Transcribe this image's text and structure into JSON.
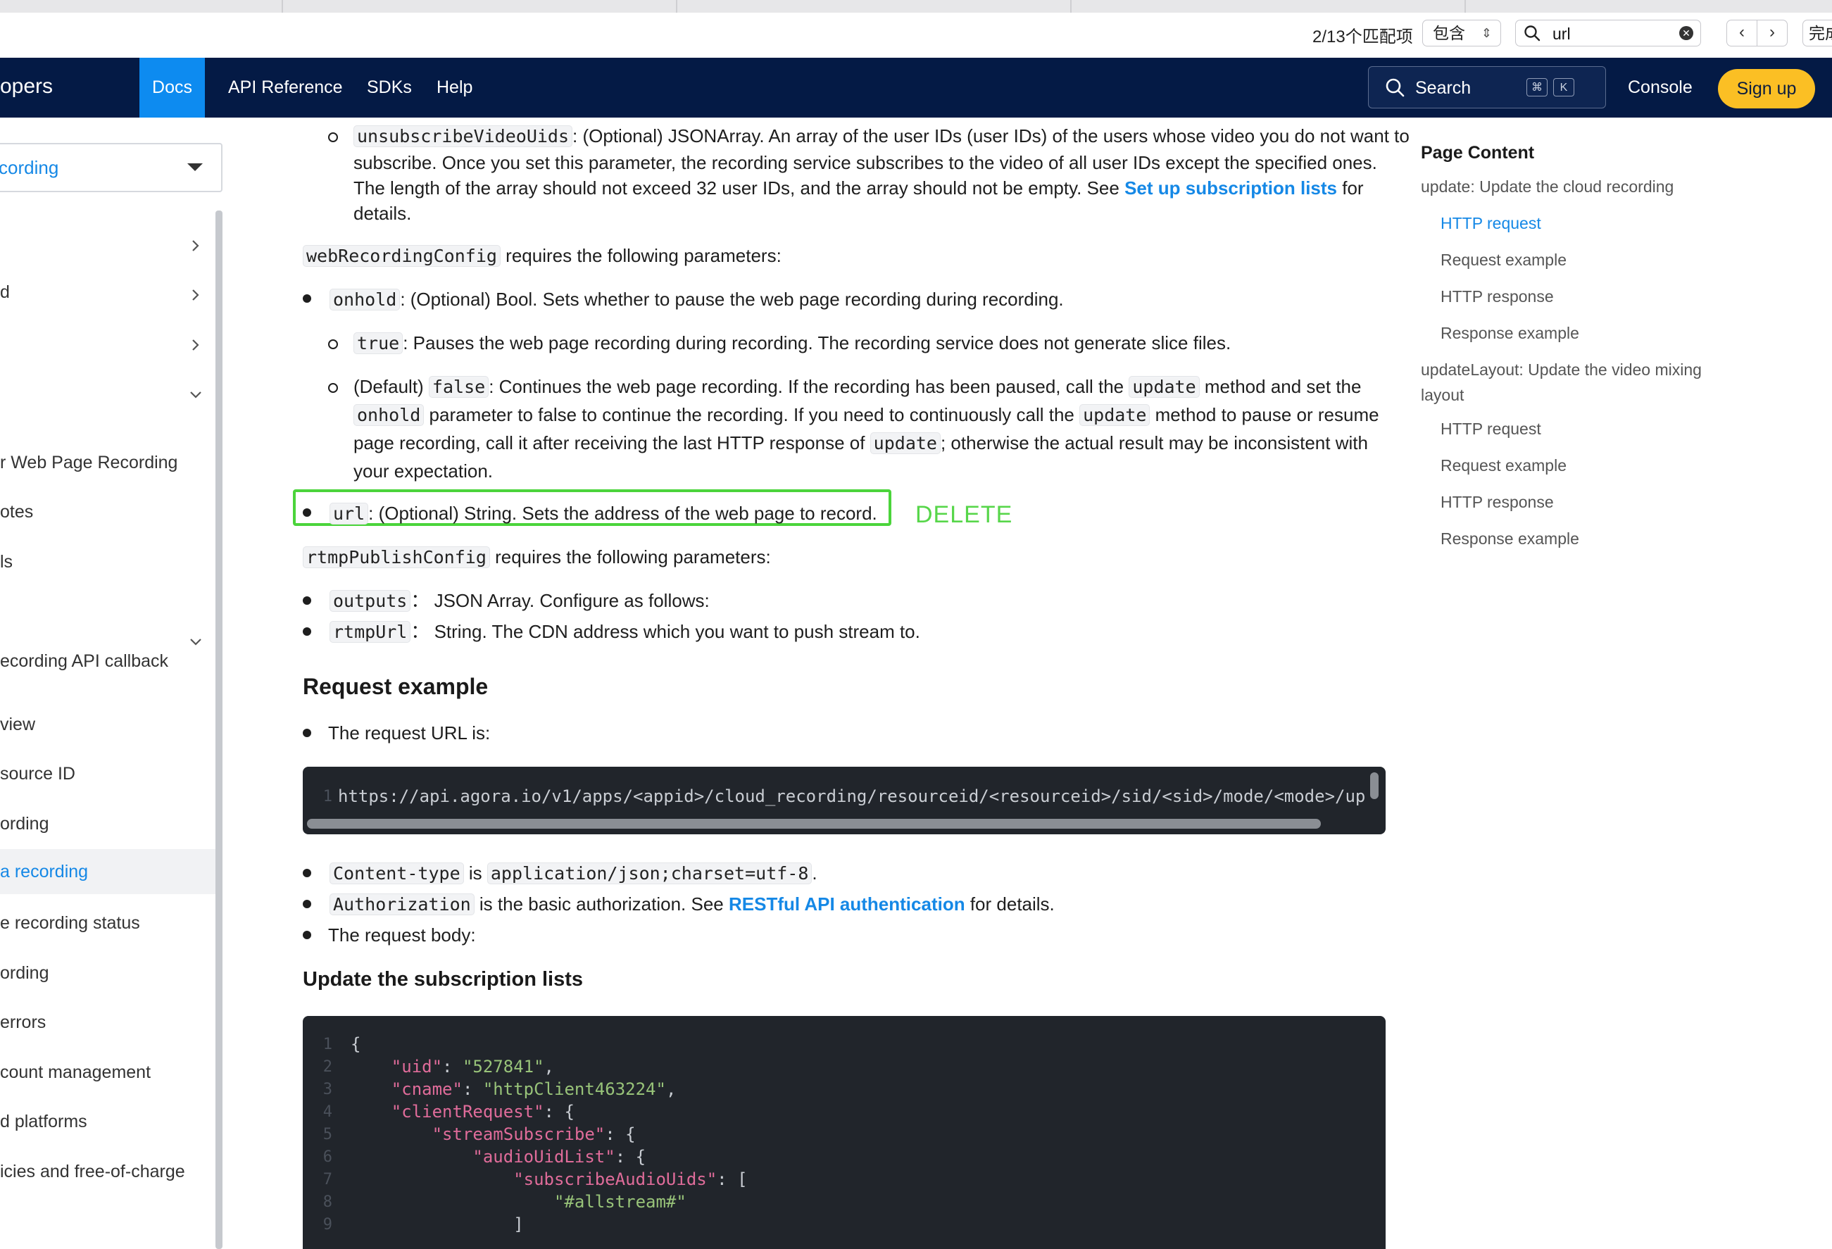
{
  "find_bar": {
    "match_count": "2/13个匹配项",
    "mode": "包含",
    "query": "url",
    "done_label": "完成"
  },
  "nav": {
    "brand": "opers",
    "docs": "Docs",
    "api_reference": "API Reference",
    "sdks": "SDKs",
    "help": "Help",
    "search_label": "Search",
    "kbd_cmd": "⌘",
    "kbd_k": "K",
    "console": "Console",
    "signup": "Sign up"
  },
  "sidebar": {
    "select_label": "cording",
    "items": [
      {
        "label": "",
        "chevron": "right"
      },
      {
        "label": "d",
        "chevron": "right"
      },
      {
        "label": "",
        "chevron": "right"
      },
      {
        "label": "",
        "chevron": "down"
      },
      {
        "label": "r Web Page Recording"
      },
      {
        "label": "otes"
      },
      {
        "label": "ls"
      },
      {
        "label": "",
        "chevron": "down"
      },
      {
        "label": "ecording API callback"
      },
      {
        "label": "view"
      },
      {
        "label": "source ID"
      },
      {
        "label": "ording"
      },
      {
        "label": "a recording",
        "active": true
      },
      {
        "label": "e recording status"
      },
      {
        "label": "ording"
      },
      {
        "label": "errors"
      },
      {
        "label": "count management"
      },
      {
        "label": "d platforms"
      },
      {
        "label": "icies and free-of-charge"
      }
    ]
  },
  "content": {
    "unsub_code": "unsubscribeVideoUids",
    "unsub_line1": ": (Optional) JSONArray. An array of the user IDs (user IDs) of the users whose video you do not want to",
    "unsub_line2": "subscribe. Once you set this parameter, the recording service subscribes to the video of all user IDs except the specified ones.",
    "unsub_line3_pre": "The length of the array should not exceed 32 user IDs, and the array should not be empty. See ",
    "unsub_link": "Set up subscription lists",
    "unsub_line3_post": " for",
    "unsub_line4": "details.",
    "webcfg_code": "webRecordingConfig",
    "webcfg_text": " requires the following parameters:",
    "onhold_code": "onhold",
    "onhold_text": ": (Optional) Bool. Sets whether to pause the web page recording during recording.",
    "true_code": "true",
    "true_text": ": Pauses the web page recording during recording. The recording service does not generate slice files.",
    "default_pre": "(Default) ",
    "false_code": "false",
    "false_text": ": Continues the web page recording. If the recording has been paused, call the ",
    "update_code": "update",
    "false_text2": " method and set the",
    "onhold2_code": "onhold",
    "line2_text": " parameter to false to continue the recording. If you need to continuously call the ",
    "update2_code": "update",
    "line2_text2": " method to pause or resume",
    "line3_text": "page recording, call it after receiving the last HTTP response of ",
    "update3_code": "update",
    "line3_text2": "; otherwise the actual result may be inconsistent with",
    "line4_text": "your expectation.",
    "url_code": "url",
    "url_text": ": (Optional) String. Sets the address of the web page to record.",
    "delete_note": "DELETE",
    "rtmp_code": "rtmpPublishConfig",
    "rtmp_text": " requires the following parameters:",
    "outputs_code": "outputs",
    "outputs_text": "：  JSON Array. Configure as follows:",
    "rtmpurl_code": "rtmpUrl",
    "rtmpurl_text": "：  String. The CDN address which you want to push stream to.",
    "req_heading": "Request example",
    "req_url_intro": "The request URL is:",
    "req_url_ln": "1",
    "req_url": "https://api.agora.io/v1/apps/<appid>/cloud_recording/resourceid/<resourceid>/sid/<sid>/mode/<mode>/up",
    "ct_code": "Content-type",
    "ct_is": " is ",
    "ct_value": "application/json;charset=utf-8",
    "ct_end": ".",
    "auth_code": "Authorization",
    "auth_text": " is the basic authorization. See ",
    "auth_link": "RESTful API authentication",
    "auth_end": " for details.",
    "body_intro": "The request body:",
    "sub_heading": "Update the subscription lists"
  },
  "code_lines": [
    {
      "n": "1",
      "indent": "",
      "key": "",
      "sep": "",
      "val": "",
      "punct": "{"
    },
    {
      "n": "2",
      "indent": "    ",
      "key": "\"uid\"",
      "sep": ": ",
      "val": "\"527841\"",
      "punct": ","
    },
    {
      "n": "3",
      "indent": "    ",
      "key": "\"cname\"",
      "sep": ": ",
      "val": "\"httpClient463224\"",
      "punct": ","
    },
    {
      "n": "4",
      "indent": "    ",
      "key": "\"clientRequest\"",
      "sep": ": ",
      "val": "",
      "punct": "{"
    },
    {
      "n": "5",
      "indent": "        ",
      "key": "\"streamSubscribe\"",
      "sep": ": ",
      "val": "",
      "punct": "{"
    },
    {
      "n": "6",
      "indent": "            ",
      "key": "\"audioUidList\"",
      "sep": ": ",
      "val": "",
      "punct": "{"
    },
    {
      "n": "7",
      "indent": "                ",
      "key": "\"subscribeAudioUids\"",
      "sep": ": ",
      "val": "",
      "punct": "["
    },
    {
      "n": "8",
      "indent": "                    ",
      "key": "",
      "sep": "",
      "val": "\"#allstream#\"",
      "punct": ""
    },
    {
      "n": "9",
      "indent": "                ",
      "key": "",
      "sep": "",
      "val": "",
      "punct": "]"
    }
  ],
  "toc": {
    "title": "Page Content",
    "items": [
      {
        "label": "update: Update the cloud recording",
        "level": 1
      },
      {
        "label": "HTTP request",
        "level": 2,
        "active": true
      },
      {
        "label": "Request example",
        "level": 2
      },
      {
        "label": "HTTP response",
        "level": 2
      },
      {
        "label": "Response example",
        "level": 2
      },
      {
        "label": "updateLayout: Update the video mixing",
        "level": 1
      },
      {
        "label": "layout",
        "level": 1
      },
      {
        "label": "HTTP request",
        "level": 2
      },
      {
        "label": "Request example",
        "level": 2
      },
      {
        "label": "HTTP response",
        "level": 2
      },
      {
        "label": "Response example",
        "level": 2
      }
    ]
  },
  "colors": {
    "nav_bg": "#041a45",
    "accent": "#1588e6",
    "highlight": "#4bd43b",
    "signup": "#fbbf24",
    "code_bg": "#21252b"
  }
}
